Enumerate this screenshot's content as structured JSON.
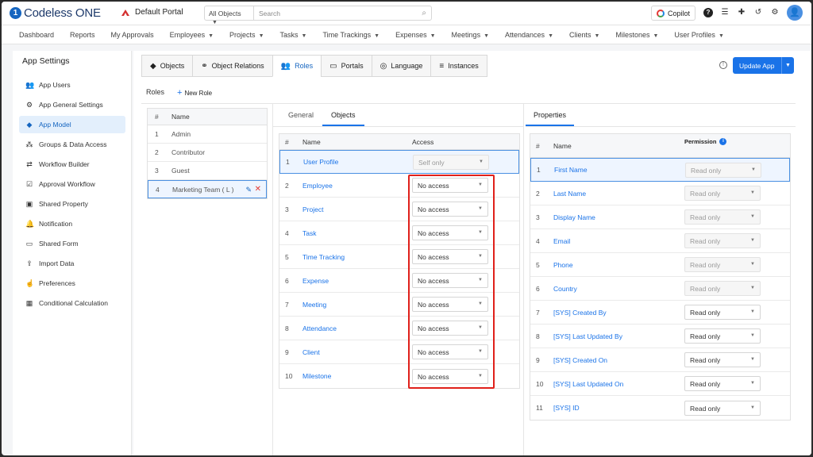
{
  "header": {
    "logo_text": "Codeless ONE",
    "portal_name": "Default Portal",
    "object_filter": "All Objects",
    "search_placeholder": "Search",
    "copilot_label": "Copilot"
  },
  "nav": [
    "Dashboard",
    "Reports",
    "My Approvals",
    "Employees",
    "Projects",
    "Tasks",
    "Time Trackings",
    "Expenses",
    "Meetings",
    "Attendances",
    "Clients",
    "Milestones",
    "User Profiles"
  ],
  "nav_dropdown_from": 3,
  "sidebar": {
    "title": "App Settings",
    "items": [
      {
        "label": "App Users",
        "icon": "users-icon"
      },
      {
        "label": "App General Settings",
        "icon": "gear-icon"
      },
      {
        "label": "App Model",
        "icon": "cube-icon",
        "active": true
      },
      {
        "label": "Groups & Data Access",
        "icon": "group-icon"
      },
      {
        "label": "Workflow Builder",
        "icon": "workflow-icon"
      },
      {
        "label": "Approval Workflow",
        "icon": "approval-icon"
      },
      {
        "label": "Shared Property",
        "icon": "property-icon"
      },
      {
        "label": "Notification",
        "icon": "bell-icon"
      },
      {
        "label": "Shared Form",
        "icon": "form-icon"
      },
      {
        "label": "Import Data",
        "icon": "upload-icon"
      },
      {
        "label": "Preferences",
        "icon": "preferences-icon"
      },
      {
        "label": "Conditional Calculation",
        "icon": "calculator-icon"
      }
    ]
  },
  "tabs": [
    {
      "label": "Objects",
      "icon": "cube-icon"
    },
    {
      "label": "Object Relations",
      "icon": "relations-icon"
    },
    {
      "label": "Roles",
      "icon": "users-icon",
      "active": true
    },
    {
      "label": "Portals",
      "icon": "monitor-icon"
    },
    {
      "label": "Language",
      "icon": "globe-icon"
    },
    {
      "label": "Instances",
      "icon": "database-icon"
    }
  ],
  "update_button": "Update App",
  "roles": {
    "label": "Roles",
    "new_role": "New Role",
    "headers": {
      "num": "#",
      "name": "Name"
    },
    "rows": [
      "Admin",
      "Contributor",
      "Guest",
      "Marketing Team ( L )"
    ],
    "selected_index": 3
  },
  "objects_panel": {
    "sub_tabs": [
      "General",
      "Objects"
    ],
    "active_sub_tab": 1,
    "headers": {
      "num": "#",
      "name": "Name",
      "access": "Access"
    },
    "rows": [
      {
        "name": "User Profile",
        "access": "Self only",
        "disabled": true,
        "selected": true
      },
      {
        "name": "Employee",
        "access": "No access"
      },
      {
        "name": "Project",
        "access": "No access"
      },
      {
        "name": "Task",
        "access": "No access"
      },
      {
        "name": "Time Tracking",
        "access": "No access"
      },
      {
        "name": "Expense",
        "access": "No access"
      },
      {
        "name": "Meeting",
        "access": "No access"
      },
      {
        "name": "Attendance",
        "access": "No access"
      },
      {
        "name": "Client",
        "access": "No access"
      },
      {
        "name": "Milestone",
        "access": "No access"
      }
    ]
  },
  "properties_panel": {
    "tab": "Properties",
    "headers": {
      "num": "#",
      "name": "Name",
      "permission": "Permission"
    },
    "rows": [
      {
        "name": "First Name",
        "permission": "Read only",
        "disabled": true,
        "selected": true
      },
      {
        "name": "Last Name",
        "permission": "Read only",
        "disabled": true
      },
      {
        "name": "Display Name",
        "permission": "Read only",
        "disabled": true
      },
      {
        "name": "Email",
        "permission": "Read only",
        "disabled": true
      },
      {
        "name": "Phone",
        "permission": "Read only",
        "disabled": true
      },
      {
        "name": "Country",
        "permission": "Read only",
        "disabled": true
      },
      {
        "name": "[SYS] Created By",
        "permission": "Read only"
      },
      {
        "name": "[SYS] Last Updated By",
        "permission": "Read only"
      },
      {
        "name": "[SYS] Created On",
        "permission": "Read only"
      },
      {
        "name": "[SYS] Last Updated On",
        "permission": "Read only"
      },
      {
        "name": "[SYS] ID",
        "permission": "Read only"
      }
    ]
  },
  "colors": {
    "accent": "#1a73e8",
    "highlight": "#e0201a",
    "active_bg": "#e3effc"
  }
}
